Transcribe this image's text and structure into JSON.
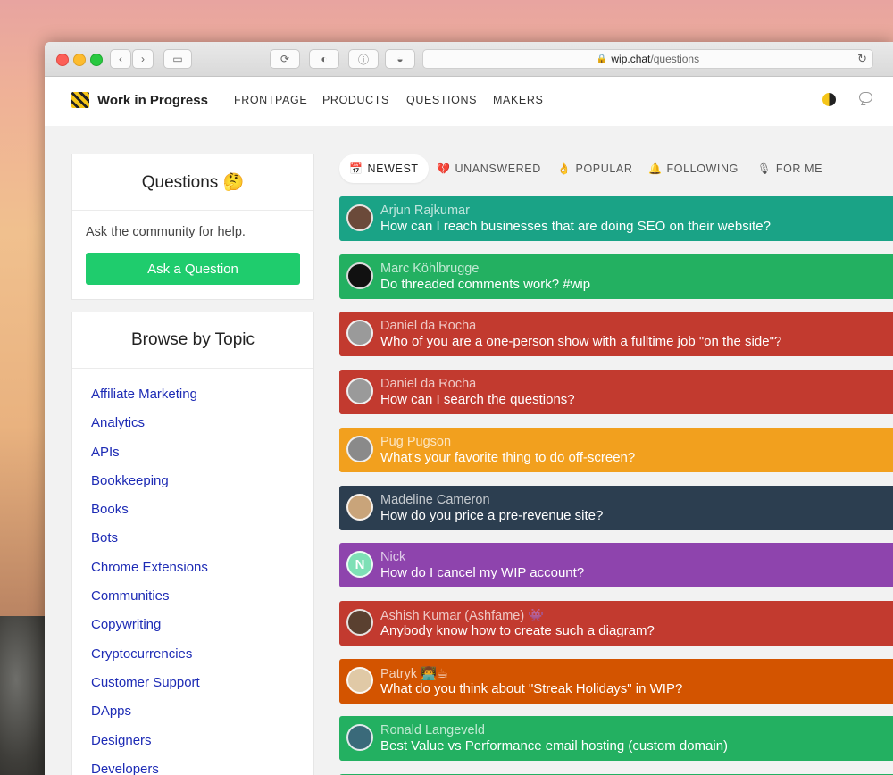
{
  "browser": {
    "url_host": "wip.chat",
    "url_path": "/questions"
  },
  "nav": {
    "brand": "Work in Progress",
    "links": [
      "FRONTPAGE",
      "PRODUCTS",
      "QUESTIONS",
      "MAKERS"
    ]
  },
  "sidebar": {
    "questions_title": "Questions 🤔",
    "questions_desc": "Ask the community for help.",
    "ask_button": "Ask a Question",
    "topics_title": "Browse by Topic",
    "topics": [
      "Affiliate Marketing",
      "Analytics",
      "APIs",
      "Bookkeeping",
      "Books",
      "Bots",
      "Chrome Extensions",
      "Communities",
      "Copywriting",
      "Cryptocurrencies",
      "Customer Support",
      "DApps",
      "Designers",
      "Developers"
    ]
  },
  "tabs": [
    {
      "emoji": "📅",
      "label": "NEWEST",
      "active": true
    },
    {
      "emoji": "💔",
      "label": "UNANSWERED",
      "active": false
    },
    {
      "emoji": "👌",
      "label": "POPULAR",
      "active": false
    },
    {
      "emoji": "🔔",
      "label": "FOLLOWING",
      "active": false
    },
    {
      "emoji": "🎙",
      "label": "FOR ME",
      "active": false
    }
  ],
  "questions": [
    {
      "author": "Arjun Rajkumar",
      "text": "How can I reach businesses that are doing SEO on their website?",
      "color": "#1aa386",
      "avatar_color": "#6b4a3a",
      "avatar_text": ""
    },
    {
      "author": "Marc Köhlbrugge",
      "text": "Do threaded comments work? #wip",
      "color": "#23b061",
      "avatar_color": "#111111",
      "avatar_text": ""
    },
    {
      "author": "Daniel da Rocha",
      "text": "Who of you are a one-person show with a fulltime job \"on the side\"?",
      "color": "#c23a2f",
      "avatar_color": "#9a9a9a",
      "avatar_text": ""
    },
    {
      "author": "Daniel da Rocha",
      "text": "How can I search the questions?",
      "color": "#c23a2f",
      "avatar_color": "#9a9a9a",
      "avatar_text": ""
    },
    {
      "author": "Pug Pugson",
      "text": "What's your favorite thing to do off-screen?",
      "color": "#f2a01e",
      "avatar_color": "#8a8a8a",
      "avatar_text": ""
    },
    {
      "author": "Madeline Cameron",
      "text": "How do you price a pre-revenue site?",
      "color": "#2c3e50",
      "avatar_color": "#c9a47a",
      "avatar_text": ""
    },
    {
      "author": "Nick",
      "text": "How do I cancel my WIP account?",
      "color": "#8e44ad",
      "avatar_color": "#7ee0b6",
      "avatar_text": "N"
    },
    {
      "author": "Ashish Kumar (Ashfame) 👾",
      "text": "Anybody know how to create such a diagram?",
      "color": "#c23a2f",
      "avatar_color": "#5a4030",
      "avatar_text": ""
    },
    {
      "author": "Patryk 👨‍💻☕",
      "text": "What do you think about \"Streak Holidays\" in WIP?",
      "color": "#d35400",
      "avatar_color": "#e0c9a6",
      "avatar_text": ""
    },
    {
      "author": "Ronald Langeveld",
      "text": "Best Value vs Performance email hosting (custom domain)",
      "color": "#23b061",
      "avatar_color": "#3a6a7a",
      "avatar_text": ""
    }
  ]
}
